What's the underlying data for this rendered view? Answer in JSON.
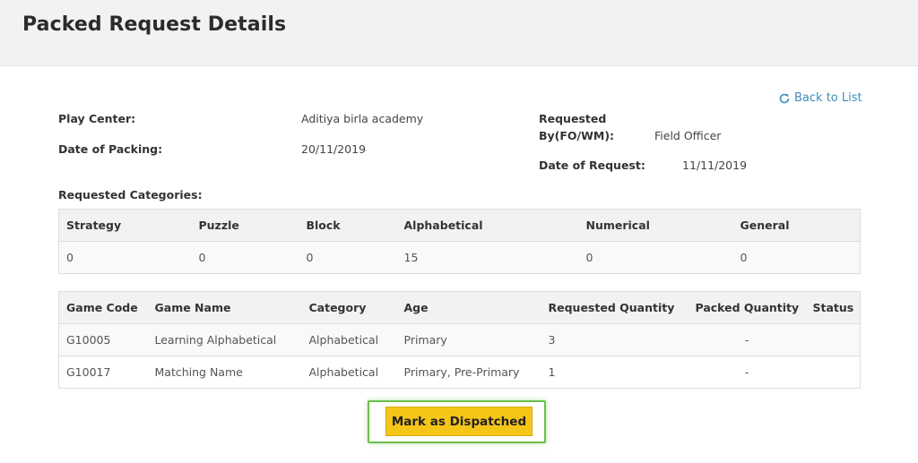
{
  "page": {
    "title": "Packed Request Details"
  },
  "back_link": {
    "label": "Back to List",
    "icon": "refresh-icon",
    "color": "#3c8dbc"
  },
  "details": {
    "play_center_label": "Play Center:",
    "play_center_value": "Aditiya birla academy",
    "date_of_packing_label": "Date of Packing:",
    "date_of_packing_value": "20/11/2019",
    "requested_by_label_line1": "Requested",
    "requested_by_label_line2": "By(FO/WM):",
    "requested_by_value": "Field Officer",
    "date_of_request_label": "Date of Request:",
    "date_of_request_value": "11/11/2019"
  },
  "categories": {
    "label": "Requested Categories:",
    "headers": [
      "Strategy",
      "Puzzle",
      "Block",
      "Alphabetical",
      "Numerical",
      "General"
    ],
    "values": [
      "0",
      "0",
      "0",
      "15",
      "0",
      "0"
    ]
  },
  "games": {
    "headers": [
      "Game Code",
      "Game Name",
      "Category",
      "Age",
      "Requested Quantity",
      "Packed Quantity",
      "Status"
    ],
    "rows": [
      [
        "G10005",
        "Learning Alphabetical",
        "Alphabetical",
        "Primary",
        "3",
        "-",
        ""
      ],
      [
        "G10017",
        "Matching Name",
        "Alphabetical",
        "Primary, Pre-Primary",
        "1",
        "-",
        ""
      ]
    ]
  },
  "actions": {
    "dispatch_label": "Mark as Dispatched",
    "accent": "#f5c518",
    "highlight": "#6abf4b"
  }
}
